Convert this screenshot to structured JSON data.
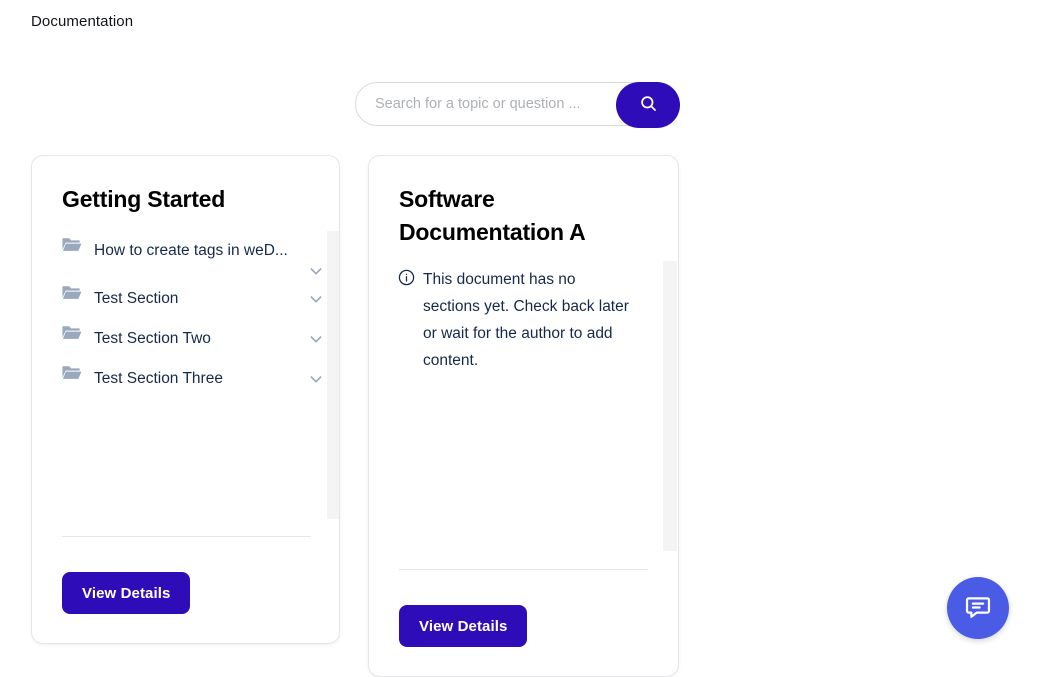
{
  "header": {
    "title": "Documentation"
  },
  "search": {
    "placeholder": "Search for a topic or question ...",
    "value": "",
    "button_icon": "search-icon",
    "button_color": "#2e0cb8"
  },
  "cards": [
    {
      "title": "Getting Started",
      "sections": [
        {
          "label": "How to create tags in weD...",
          "icon": "folder-icon",
          "toggle_icon": "chevron-down-icon"
        },
        {
          "label": "Test Section",
          "icon": "folder-icon",
          "toggle_icon": "chevron-down-icon"
        },
        {
          "label": "Test Section Two",
          "icon": "folder-icon",
          "toggle_icon": "chevron-down-icon"
        },
        {
          "label": "Test Section Three",
          "icon": "folder-icon",
          "toggle_icon": "chevron-down-icon"
        }
      ],
      "empty_note": "",
      "button_label": "View Details"
    },
    {
      "title": "Software Documentation A",
      "sections": [],
      "empty_note": "This document has no sections yet. Check back later or wait for the author to add content.",
      "empty_note_icon": "info-circle-icon",
      "button_label": "View Details"
    }
  ],
  "chat": {
    "icon": "chat-bubble-icon",
    "color": "#4a5ce6"
  },
  "colors": {
    "primary": "#2e0cb8",
    "accent": "#4a5ce6",
    "text_dark": "#17294a",
    "icon_muted": "#9aa8bd",
    "card_border": "#e7e7e9",
    "scroll_track": "#f4f4f4"
  }
}
